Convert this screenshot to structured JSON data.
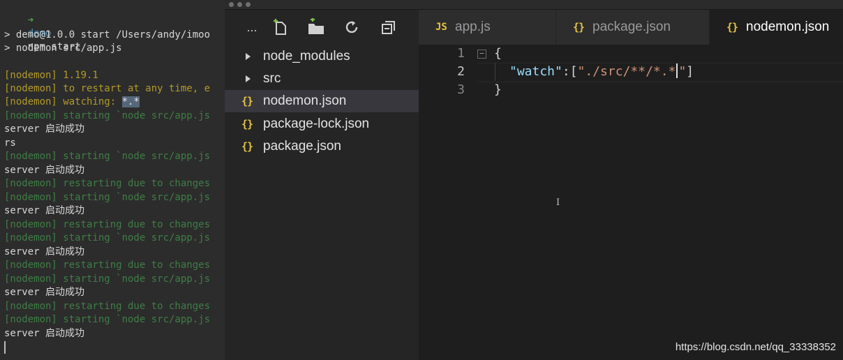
{
  "terminal": {
    "prompt_arrow": "➜",
    "prompt_dir": "demo",
    "prompt_cmd": "npm start",
    "lines": [
      {
        "text": "> demo@1.0.0 start /Users/andy/imoo",
        "color": "white"
      },
      {
        "text": "> nodemon src/app.js",
        "color": "white"
      },
      {
        "text": "[nodemon] 1.19.1",
        "color": "yellow"
      },
      {
        "text": "[nodemon] to restart at any time, e",
        "color": "yellow"
      },
      {
        "text": "[nodemon] watching: ",
        "color": "yellow",
        "highlight": "*.*"
      },
      {
        "text": "[nodemon] starting `node src/app.js",
        "color": "dgreen"
      },
      {
        "text": "server 启动成功",
        "color": "white"
      },
      {
        "text": "rs",
        "color": "white"
      },
      {
        "text": "[nodemon] starting `node src/app.js",
        "color": "dgreen"
      },
      {
        "text": "server 启动成功",
        "color": "white"
      },
      {
        "text": "[nodemon] restarting due to changes",
        "color": "dgreen"
      },
      {
        "text": "[nodemon] starting `node src/app.js",
        "color": "dgreen"
      },
      {
        "text": "server 启动成功",
        "color": "white"
      },
      {
        "text": "[nodemon] restarting due to changes",
        "color": "dgreen"
      },
      {
        "text": "[nodemon] starting `node src/app.js",
        "color": "dgreen"
      },
      {
        "text": "server 启动成功",
        "color": "white"
      },
      {
        "text": "[nodemon] restarting due to changes",
        "color": "dgreen"
      },
      {
        "text": "[nodemon] starting `node src/app.js",
        "color": "dgreen"
      },
      {
        "text": "server 启动成功",
        "color": "white"
      },
      {
        "text": "[nodemon] restarting due to changes",
        "color": "dgreen"
      },
      {
        "text": "[nodemon] starting `node src/app.js",
        "color": "dgreen"
      },
      {
        "text": "server 启动成功",
        "color": "white"
      }
    ]
  },
  "sidebar": {
    "more_label": "...",
    "toolbar_icons": [
      "new-file-icon",
      "new-folder-icon",
      "refresh-icon",
      "collapse-all-icon"
    ],
    "tree": [
      {
        "label": "node_modules",
        "type": "folder"
      },
      {
        "label": "src",
        "type": "folder"
      },
      {
        "label": "nodemon.json",
        "type": "json",
        "active": true
      },
      {
        "label": "package-lock.json",
        "type": "json"
      },
      {
        "label": "package.json",
        "type": "json"
      }
    ],
    "json_icon": "{}"
  },
  "tabs": [
    {
      "label": "app.js",
      "icon": "JS"
    },
    {
      "label": "package.json",
      "icon": "{}"
    },
    {
      "label": "nodemon.json",
      "icon": "{}",
      "active": true
    }
  ],
  "editor": {
    "line_numbers": [
      "1",
      "2",
      "3"
    ],
    "line1": "{",
    "line2_key": "\"watch\"",
    "line2_colon": ":[",
    "line2_str": "\"./src/**/*.*",
    "line2_str_end": "\"",
    "line2_close": "]",
    "line3": "}",
    "fold_glyph": "−",
    "ibeam": "I"
  },
  "watermark": "https://blog.csdn.net/qq_33338352",
  "colors": {
    "terminal_bg": "#2c2c2c",
    "editor_bg": "#1e1e1e",
    "sidebar_bg": "#252526",
    "json_icon": "#e5c341",
    "string": "#ce9178",
    "key": "#9cdcfe"
  }
}
